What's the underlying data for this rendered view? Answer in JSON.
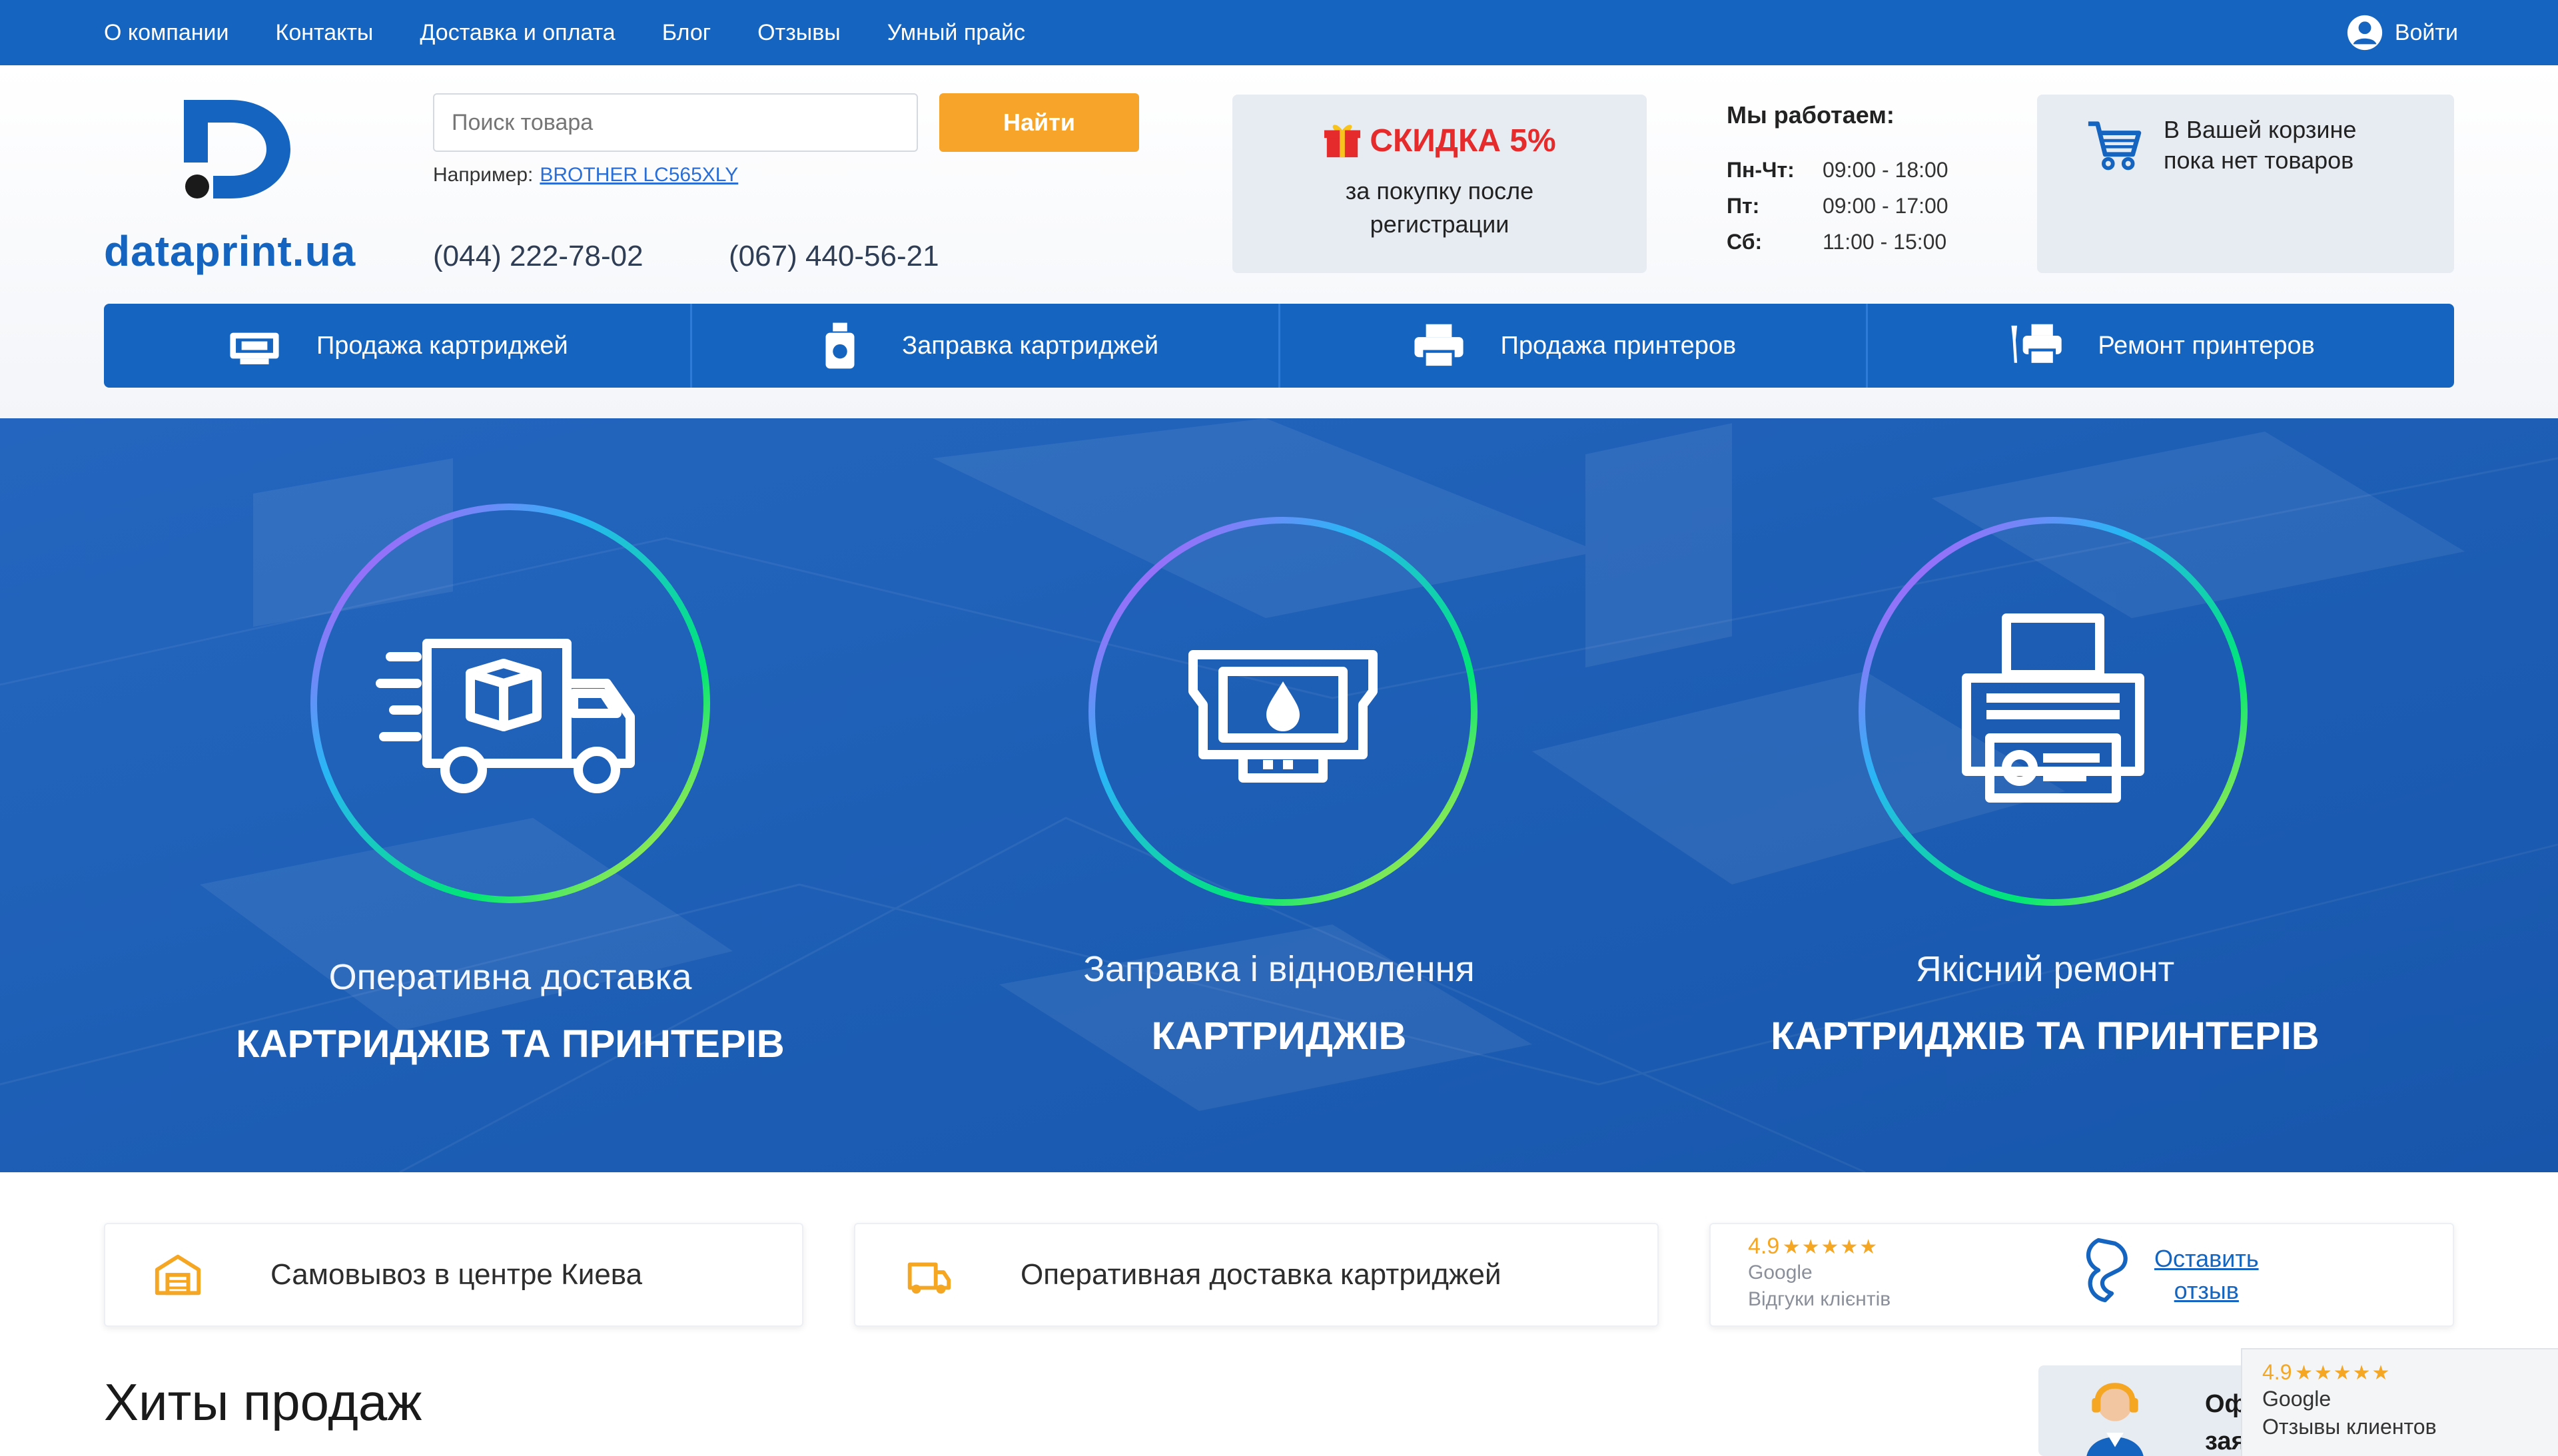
{
  "topbar": {
    "nav": [
      "О компании",
      "Контакты",
      "Доставка и оплата",
      "Блог",
      "Отзывы",
      "Умный прайс"
    ],
    "login_label": "Войти",
    "background": "#1565c0"
  },
  "header": {
    "logo_text": "dataprint.ua",
    "search_placeholder": "Поиск товара",
    "search_button": "Найти",
    "example_label": "Например:",
    "example_link": "BROTHER LC565XLY",
    "phones": [
      "(044) 222-78-02",
      "(067) 440-56-21"
    ],
    "promo": {
      "title": "СКИДКА 5%",
      "line1": "за покупку после",
      "line2": "регистрации"
    },
    "hours": {
      "title": "Мы работаем:",
      "rows": [
        {
          "day": "Пн-Чт:",
          "time": "09:00 - 18:00"
        },
        {
          "day": "Пт:",
          "time": "09:00 - 17:00"
        },
        {
          "day": "Сб:",
          "time": "11:00 - 15:00"
        }
      ]
    },
    "cart": {
      "line1": "В Вашей корзине",
      "line2": "пока нет товаров"
    }
  },
  "categories": [
    {
      "label": "Продажа картриджей",
      "icon": "cartridge-icon"
    },
    {
      "label": "Заправка картриджей",
      "icon": "ink-bottle-icon"
    },
    {
      "label": "Продажа принтеров",
      "icon": "printer-icon"
    },
    {
      "label": "Ремонт принтеров",
      "icon": "printer-repair-icon"
    }
  ],
  "hero": {
    "features": [
      {
        "line1": "Оперативна доставка",
        "line2": "КАРТРИДЖІВ ТА ПРИНТЕРІВ",
        "icon": "delivery-truck-icon"
      },
      {
        "line1": "Заправка і відновлення",
        "line2": "КАРТРИДЖІВ",
        "icon": "ink-cartridge-icon"
      },
      {
        "line1": "Якісний ремонт",
        "line2": "КАРТРИДЖІВ ТА ПРИНТЕРІВ",
        "icon": "printer-icon"
      }
    ]
  },
  "info": {
    "pickup": "Самовывоз в центре Киева",
    "delivery": "Оперативная доставка картриджей",
    "rating_value": "4.9",
    "rating_stars": "★★★★★",
    "rating_source": "Google",
    "rating_label": "Відгуки клієнтів",
    "review_line1": "Оставить",
    "review_line2": "отзыв"
  },
  "hits_title": "Хиты продаж",
  "support": {
    "line1": "Оф",
    "line2": "заяв"
  },
  "google_widget": {
    "value": "4.9",
    "stars": "★★★★★",
    "source": "Google",
    "label": "Отзывы клиентов"
  }
}
